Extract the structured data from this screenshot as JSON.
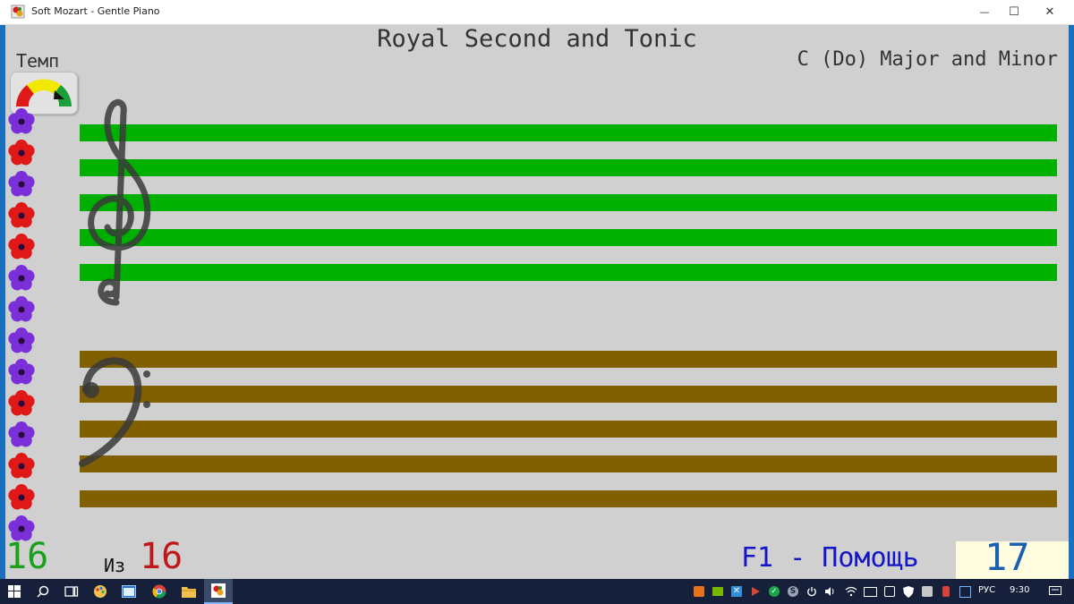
{
  "window": {
    "title": "Soft Mozart - Gentle Piano",
    "minimize_glyph": "—",
    "maximize_glyph": "☐",
    "close_glyph": "✕"
  },
  "song": {
    "title": "Royal Second and Tonic",
    "key": "C (Do) Major and Minor"
  },
  "tempo": {
    "label": "Темп"
  },
  "counter": {
    "current": "16",
    "of_label": "Из",
    "total": "16"
  },
  "help": {
    "label": "F1 - Помощь"
  },
  "score": {
    "value": "17"
  },
  "tray": {
    "language": "РУС",
    "time": "9:30"
  },
  "colors": {
    "treble_staff": "#00b000",
    "bass_staff": "#806000",
    "flower_purple": "#7a2fd8",
    "flower_red": "#e01818",
    "counter_current": "#1aa01a",
    "counter_total": "#c01818"
  },
  "flowers": [
    "purple",
    "red",
    "purple",
    "red",
    "red",
    "purple",
    "purple",
    "purple",
    "purple",
    "red",
    "purple",
    "red",
    "red",
    "purple"
  ]
}
